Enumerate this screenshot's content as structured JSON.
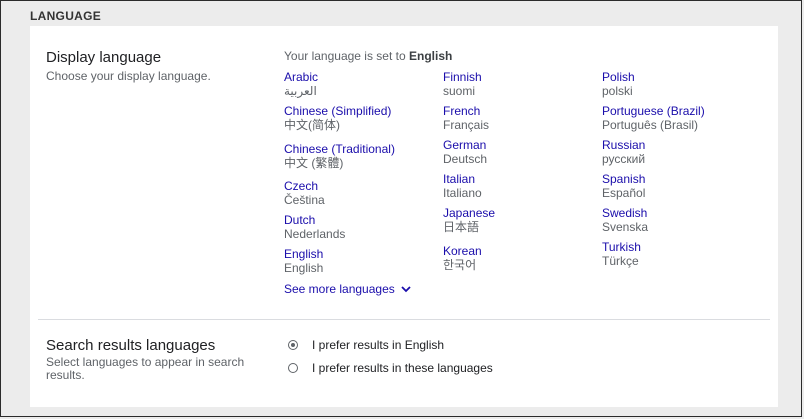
{
  "section_heading": "LANGUAGE",
  "display_language": {
    "title": "Display language",
    "subtitle": "Choose your display language.",
    "current_prefix": "Your language is set to",
    "current_value": "English",
    "columns": [
      [
        {
          "name": "Arabic",
          "native": "العربية"
        },
        {
          "name": "Chinese (Simplified)",
          "native": "中文(简体)"
        },
        {
          "name": "Chinese (Traditional)",
          "native": "中文 (繁體)"
        },
        {
          "name": "Czech",
          "native": "Čeština"
        },
        {
          "name": "Dutch",
          "native": "Nederlands"
        },
        {
          "name": "English",
          "native": "English"
        }
      ],
      [
        {
          "name": "Finnish",
          "native": "suomi"
        },
        {
          "name": "French",
          "native": "Français"
        },
        {
          "name": "German",
          "native": "Deutsch"
        },
        {
          "name": "Italian",
          "native": "Italiano"
        },
        {
          "name": "Japanese",
          "native": "日本語"
        },
        {
          "name": "Korean",
          "native": "한국어"
        }
      ],
      [
        {
          "name": "Polish",
          "native": "polski"
        },
        {
          "name": "Portuguese (Brazil)",
          "native": "Português (Brasil)"
        },
        {
          "name": "Russian",
          "native": "русский"
        },
        {
          "name": "Spanish",
          "native": "Español"
        },
        {
          "name": "Swedish",
          "native": "Svenska"
        },
        {
          "name": "Turkish",
          "native": "Türkçe"
        }
      ]
    ],
    "see_more_label": "See more languages"
  },
  "search_results_languages": {
    "title": "Search results languages",
    "subtitle_line1": "Select languages to appear in search",
    "subtitle_line2": "results.",
    "options": [
      {
        "label": "I prefer results in English",
        "selected": true
      },
      {
        "label": "I prefer results in these languages",
        "selected": false
      }
    ]
  },
  "colors": {
    "link": "#1a0dab",
    "secondary_text": "#5f6368",
    "page_background": "#ececec",
    "card_background": "#ffffff"
  }
}
